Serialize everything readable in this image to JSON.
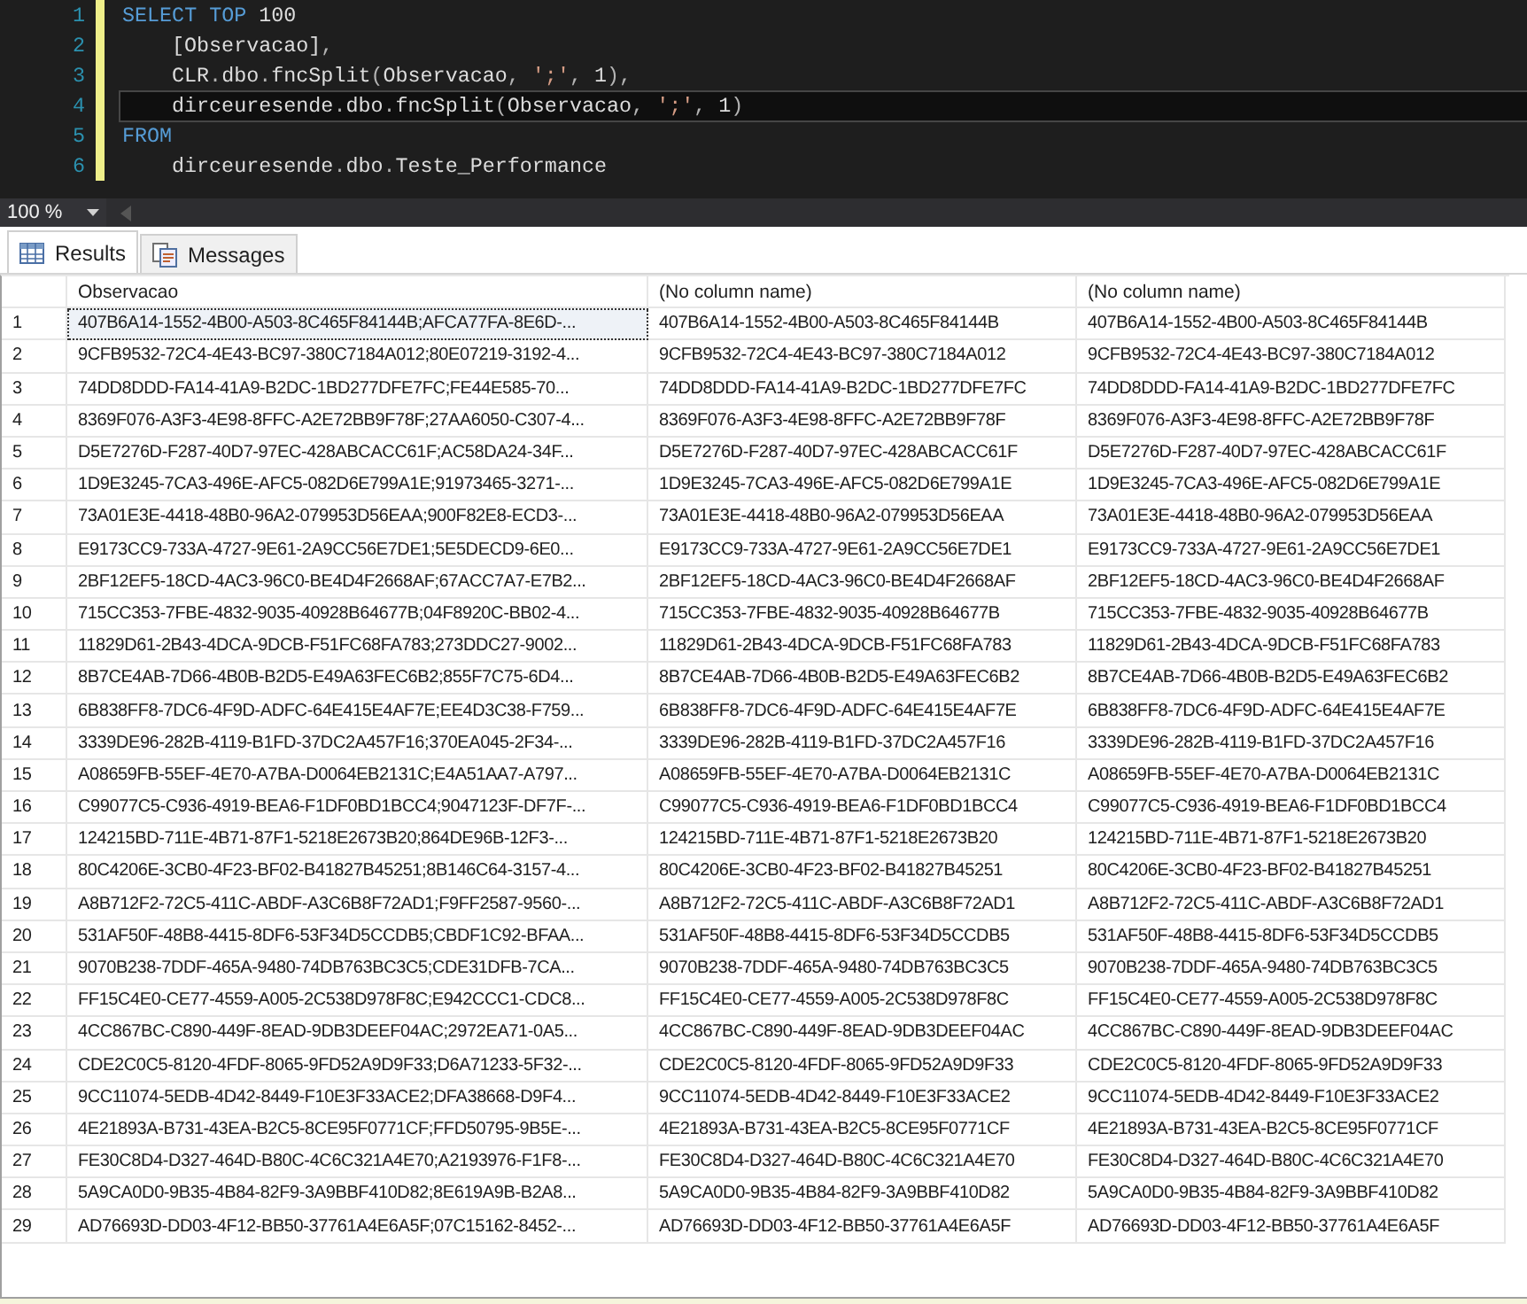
{
  "editor": {
    "lines": [
      {
        "number": "1",
        "indented": false,
        "current": false,
        "tokens": [
          {
            "kind": "keyword",
            "text": "SELECT TOP"
          },
          {
            "kind": "text",
            "text": " 100"
          }
        ]
      },
      {
        "number": "2",
        "indented": true,
        "current": false,
        "tokens": [
          {
            "kind": "text",
            "text": "[Observacao]"
          },
          {
            "kind": "punct",
            "text": ","
          }
        ]
      },
      {
        "number": "3",
        "indented": true,
        "current": false,
        "tokens": [
          {
            "kind": "text",
            "text": "CLR"
          },
          {
            "kind": "punct",
            "text": "."
          },
          {
            "kind": "text",
            "text": "dbo"
          },
          {
            "kind": "punct",
            "text": "."
          },
          {
            "kind": "text",
            "text": "fncSplit"
          },
          {
            "kind": "punct",
            "text": "("
          },
          {
            "kind": "text",
            "text": "Observacao"
          },
          {
            "kind": "punct",
            "text": ", "
          },
          {
            "kind": "string",
            "text": "';'"
          },
          {
            "kind": "punct",
            "text": ", "
          },
          {
            "kind": "text",
            "text": "1"
          },
          {
            "kind": "punct",
            "text": "),"
          }
        ]
      },
      {
        "number": "4",
        "indented": true,
        "current": true,
        "tokens": [
          {
            "kind": "text",
            "text": "dirceuresende"
          },
          {
            "kind": "punct",
            "text": "."
          },
          {
            "kind": "text",
            "text": "dbo"
          },
          {
            "kind": "punct",
            "text": "."
          },
          {
            "kind": "text",
            "text": "fncSplit"
          },
          {
            "kind": "punct",
            "text": "("
          },
          {
            "kind": "text",
            "text": "Observacao"
          },
          {
            "kind": "punct",
            "text": ", "
          },
          {
            "kind": "string",
            "text": "';'"
          },
          {
            "kind": "punct",
            "text": ", "
          },
          {
            "kind": "text",
            "text": "1"
          },
          {
            "kind": "punct",
            "text": ")"
          }
        ]
      },
      {
        "number": "5",
        "indented": false,
        "current": false,
        "tokens": [
          {
            "kind": "keyword",
            "text": "FROM"
          }
        ]
      },
      {
        "number": "6",
        "indented": true,
        "current": false,
        "tokens": [
          {
            "kind": "text",
            "text": "dirceuresende"
          },
          {
            "kind": "punct",
            "text": "."
          },
          {
            "kind": "text",
            "text": "dbo"
          },
          {
            "kind": "punct",
            "text": "."
          },
          {
            "kind": "text",
            "text": "Teste_Performance"
          }
        ]
      }
    ]
  },
  "zoom": {
    "value": "100 %"
  },
  "tabs": [
    {
      "label": "Results",
      "kind": "grid",
      "selected": true
    },
    {
      "label": "Messages",
      "kind": "messages",
      "selected": false
    }
  ],
  "table": {
    "columns": [
      "Observacao",
      "(No column name)",
      "(No column name)"
    ],
    "rows": [
      {
        "number": "1",
        "selected": true,
        "cells": [
          "407B6A14-1552-4B00-A503-8C465F84144B;AFCA77FA-8E6D-...",
          "407B6A14-1552-4B00-A503-8C465F84144B",
          "407B6A14-1552-4B00-A503-8C465F84144B"
        ]
      },
      {
        "number": "2",
        "selected": false,
        "cells": [
          "9CFB9532-72C4-4E43-BC97-380C7184A012;80E07219-3192-4...",
          "9CFB9532-72C4-4E43-BC97-380C7184A012",
          "9CFB9532-72C4-4E43-BC97-380C7184A012"
        ]
      },
      {
        "number": "3",
        "selected": false,
        "cells": [
          "74DD8DDD-FA14-41A9-B2DC-1BD277DFE7FC;FE44E585-70...",
          "74DD8DDD-FA14-41A9-B2DC-1BD277DFE7FC",
          "74DD8DDD-FA14-41A9-B2DC-1BD277DFE7FC"
        ]
      },
      {
        "number": "4",
        "selected": false,
        "cells": [
          "8369F076-A3F3-4E98-8FFC-A2E72BB9F78F;27AA6050-C307-4...",
          "8369F076-A3F3-4E98-8FFC-A2E72BB9F78F",
          "8369F076-A3F3-4E98-8FFC-A2E72BB9F78F"
        ]
      },
      {
        "number": "5",
        "selected": false,
        "cells": [
          "D5E7276D-F287-40D7-97EC-428ABCACC61F;AC58DA24-34F...",
          "D5E7276D-F287-40D7-97EC-428ABCACC61F",
          "D5E7276D-F287-40D7-97EC-428ABCACC61F"
        ]
      },
      {
        "number": "6",
        "selected": false,
        "cells": [
          "1D9E3245-7CA3-496E-AFC5-082D6E799A1E;91973465-3271-...",
          "1D9E3245-7CA3-496E-AFC5-082D6E799A1E",
          "1D9E3245-7CA3-496E-AFC5-082D6E799A1E"
        ]
      },
      {
        "number": "7",
        "selected": false,
        "cells": [
          "73A01E3E-4418-48B0-96A2-079953D56EAA;900F82E8-ECD3-...",
          "73A01E3E-4418-48B0-96A2-079953D56EAA",
          "73A01E3E-4418-48B0-96A2-079953D56EAA"
        ]
      },
      {
        "number": "8",
        "selected": false,
        "cells": [
          "E9173CC9-733A-4727-9E61-2A9CC56E7DE1;5E5DECD9-6E0...",
          "E9173CC9-733A-4727-9E61-2A9CC56E7DE1",
          "E9173CC9-733A-4727-9E61-2A9CC56E7DE1"
        ]
      },
      {
        "number": "9",
        "selected": false,
        "cells": [
          "2BF12EF5-18CD-4AC3-96C0-BE4D4F2668AF;67ACC7A7-E7B2...",
          "2BF12EF5-18CD-4AC3-96C0-BE4D4F2668AF",
          "2BF12EF5-18CD-4AC3-96C0-BE4D4F2668AF"
        ]
      },
      {
        "number": "10",
        "selected": false,
        "cells": [
          "715CC353-7FBE-4832-9035-40928B64677B;04F8920C-BB02-4...",
          "715CC353-7FBE-4832-9035-40928B64677B",
          "715CC353-7FBE-4832-9035-40928B64677B"
        ]
      },
      {
        "number": "11",
        "selected": false,
        "cells": [
          "11829D61-2B43-4DCA-9DCB-F51FC68FA783;273DDC27-9002...",
          "11829D61-2B43-4DCA-9DCB-F51FC68FA783",
          "11829D61-2B43-4DCA-9DCB-F51FC68FA783"
        ]
      },
      {
        "number": "12",
        "selected": false,
        "cells": [
          "8B7CE4AB-7D66-4B0B-B2D5-E49A63FEC6B2;855F7C75-6D4...",
          "8B7CE4AB-7D66-4B0B-B2D5-E49A63FEC6B2",
          "8B7CE4AB-7D66-4B0B-B2D5-E49A63FEC6B2"
        ]
      },
      {
        "number": "13",
        "selected": false,
        "cells": [
          "6B838FF8-7DC6-4F9D-ADFC-64E415E4AF7E;EE4D3C38-F759...",
          "6B838FF8-7DC6-4F9D-ADFC-64E415E4AF7E",
          "6B838FF8-7DC6-4F9D-ADFC-64E415E4AF7E"
        ]
      },
      {
        "number": "14",
        "selected": false,
        "cells": [
          "3339DE96-282B-4119-B1FD-37DC2A457F16;370EA045-2F34-...",
          "3339DE96-282B-4119-B1FD-37DC2A457F16",
          "3339DE96-282B-4119-B1FD-37DC2A457F16"
        ]
      },
      {
        "number": "15",
        "selected": false,
        "cells": [
          "A08659FB-55EF-4E70-A7BA-D0064EB2131C;E4A51AA7-A797...",
          "A08659FB-55EF-4E70-A7BA-D0064EB2131C",
          "A08659FB-55EF-4E70-A7BA-D0064EB2131C"
        ]
      },
      {
        "number": "16",
        "selected": false,
        "cells": [
          "C99077C5-C936-4919-BEA6-F1DF0BD1BCC4;9047123F-DF7F-...",
          "C99077C5-C936-4919-BEA6-F1DF0BD1BCC4",
          "C99077C5-C936-4919-BEA6-F1DF0BD1BCC4"
        ]
      },
      {
        "number": "17",
        "selected": false,
        "cells": [
          "124215BD-711E-4B71-87F1-5218E2673B20;864DE96B-12F3-...",
          "124215BD-711E-4B71-87F1-5218E2673B20",
          "124215BD-711E-4B71-87F1-5218E2673B20"
        ]
      },
      {
        "number": "18",
        "selected": false,
        "cells": [
          "80C4206E-3CB0-4F23-BF02-B41827B45251;8B146C64-3157-4...",
          "80C4206E-3CB0-4F23-BF02-B41827B45251",
          "80C4206E-3CB0-4F23-BF02-B41827B45251"
        ]
      },
      {
        "number": "19",
        "selected": false,
        "cells": [
          "A8B712F2-72C5-411C-ABDF-A3C6B8F72AD1;F9FF2587-9560-...",
          "A8B712F2-72C5-411C-ABDF-A3C6B8F72AD1",
          "A8B712F2-72C5-411C-ABDF-A3C6B8F72AD1"
        ]
      },
      {
        "number": "20",
        "selected": false,
        "cells": [
          "531AF50F-48B8-4415-8DF6-53F34D5CCDB5;CBDF1C92-BFAA...",
          "531AF50F-48B8-4415-8DF6-53F34D5CCDB5",
          "531AF50F-48B8-4415-8DF6-53F34D5CCDB5"
        ]
      },
      {
        "number": "21",
        "selected": false,
        "cells": [
          "9070B238-7DDF-465A-9480-74DB763BC3C5;CDE31DFB-7CA...",
          "9070B238-7DDF-465A-9480-74DB763BC3C5",
          "9070B238-7DDF-465A-9480-74DB763BC3C5"
        ]
      },
      {
        "number": "22",
        "selected": false,
        "cells": [
          "FF15C4E0-CE77-4559-A005-2C538D978F8C;E942CCC1-CDC8...",
          "FF15C4E0-CE77-4559-A005-2C538D978F8C",
          "FF15C4E0-CE77-4559-A005-2C538D978F8C"
        ]
      },
      {
        "number": "23",
        "selected": false,
        "cells": [
          "4CC867BC-C890-449F-8EAD-9DB3DEEF04AC;2972EA71-0A5...",
          "4CC867BC-C890-449F-8EAD-9DB3DEEF04AC",
          "4CC867BC-C890-449F-8EAD-9DB3DEEF04AC"
        ]
      },
      {
        "number": "24",
        "selected": false,
        "cells": [
          "CDE2C0C5-8120-4FDF-8065-9FD52A9D9F33;D6A71233-5F32-...",
          "CDE2C0C5-8120-4FDF-8065-9FD52A9D9F33",
          "CDE2C0C5-8120-4FDF-8065-9FD52A9D9F33"
        ]
      },
      {
        "number": "25",
        "selected": false,
        "cells": [
          "9CC11074-5EDB-4D42-8449-F10E3F33ACE2;DFA38668-D9F4...",
          "9CC11074-5EDB-4D42-8449-F10E3F33ACE2",
          "9CC11074-5EDB-4D42-8449-F10E3F33ACE2"
        ]
      },
      {
        "number": "26",
        "selected": false,
        "cells": [
          "4E21893A-B731-43EA-B2C5-8CE95F0771CF;FFD50795-9B5E-...",
          "4E21893A-B731-43EA-B2C5-8CE95F0771CF",
          "4E21893A-B731-43EA-B2C5-8CE95F0771CF"
        ]
      },
      {
        "number": "27",
        "selected": false,
        "cells": [
          "FE30C8D4-D327-464D-B80C-4C6C321A4E70;A2193976-F1F8-...",
          "FE30C8D4-D327-464D-B80C-4C6C321A4E70",
          "FE30C8D4-D327-464D-B80C-4C6C321A4E70"
        ]
      },
      {
        "number": "28",
        "selected": false,
        "cells": [
          "5A9CA0D0-9B35-4B84-82F9-3A9BBF410D82;8E619A9B-B2A8...",
          "5A9CA0D0-9B35-4B84-82F9-3A9BBF410D82",
          "5A9CA0D0-9B35-4B84-82F9-3A9BBF410D82"
        ]
      },
      {
        "number": "29",
        "selected": false,
        "cells": [
          "AD76693D-DD03-4F12-BB50-37761A4E6A5F;07C15162-8452-...",
          "AD76693D-DD03-4F12-BB50-37761A4E6A5F",
          "AD76693D-DD03-4F12-BB50-37761A4E6A5F"
        ]
      }
    ]
  }
}
